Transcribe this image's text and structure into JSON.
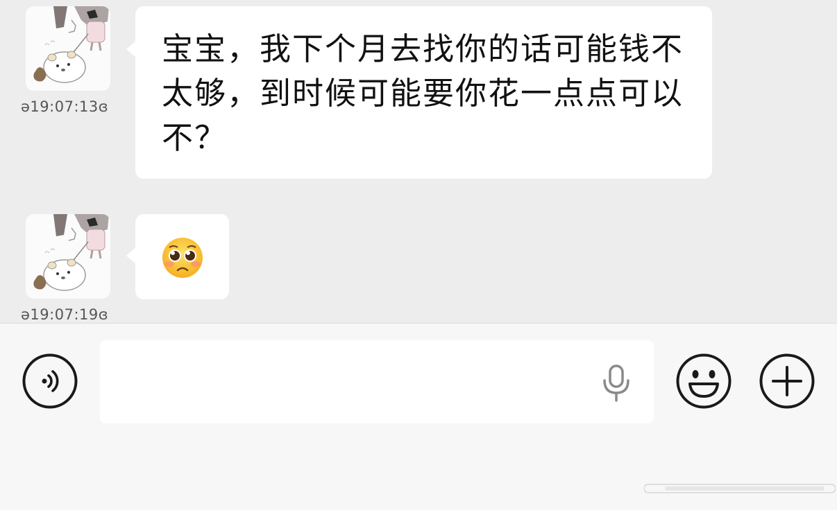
{
  "messages": [
    {
      "timestamp": "ə19:07:13ɞ",
      "text": "宝宝，我下个月去找你的话可能钱不太够，到时候可能要你花一点点可以不？"
    },
    {
      "timestamp": "ə19:07:19ɞ",
      "emoji": "🥺"
    }
  ],
  "input_bar": {
    "voice_icon": "voice-icon",
    "mic_icon": "microphone-icon",
    "emoji_icon": "smiley-face-icon",
    "add_icon": "plus-icon",
    "input_value": ""
  },
  "colors": {
    "chat_background": "#ededed",
    "bubble": "#ffffff",
    "input_bar": "#f7f7f7",
    "icon_stroke": "#1a1a1a"
  }
}
